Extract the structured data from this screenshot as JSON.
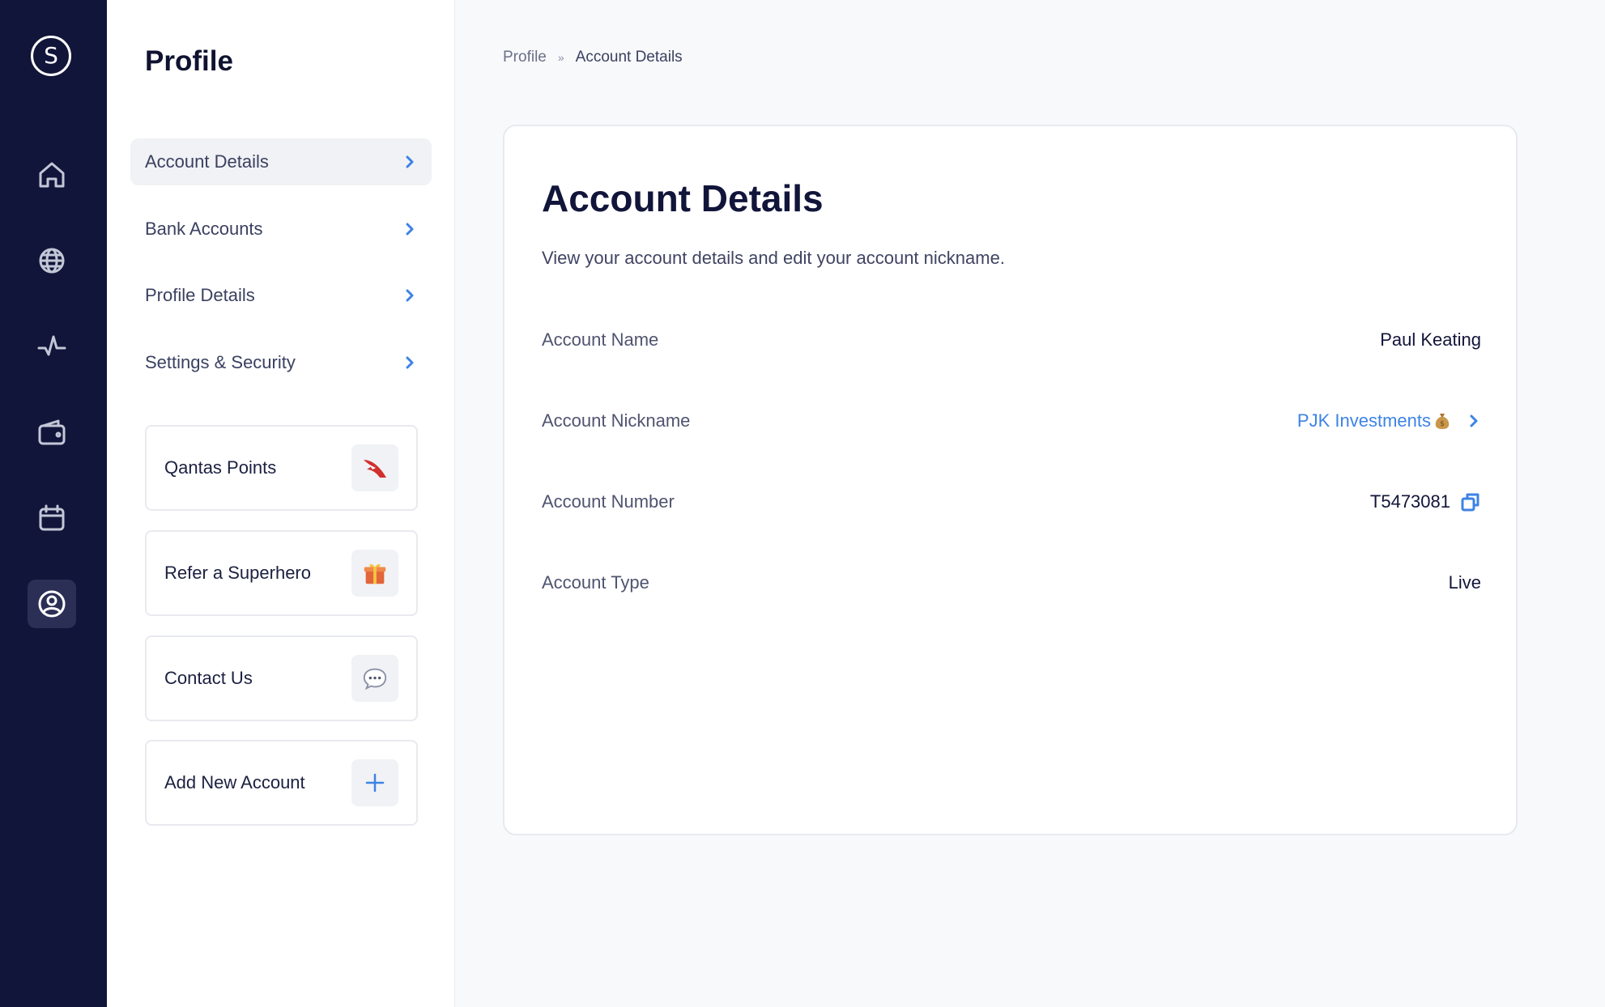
{
  "rail": {
    "logo_letter": "S",
    "items": [
      {
        "icon": "home-icon"
      },
      {
        "icon": "globe-icon"
      },
      {
        "icon": "activity-icon"
      },
      {
        "icon": "wallet-icon"
      },
      {
        "icon": "calendar-icon"
      },
      {
        "icon": "profile-icon",
        "active": true
      }
    ]
  },
  "panel": {
    "title": "Profile",
    "menu": [
      {
        "label": "Account Details",
        "active": true
      },
      {
        "label": "Bank Accounts"
      },
      {
        "label": "Profile Details"
      },
      {
        "label": "Settings & Security"
      }
    ],
    "cards": [
      {
        "label": "Qantas Points",
        "icon": "qantas-logo-icon"
      },
      {
        "label": "Refer a Superhero",
        "icon": "gift-icon"
      },
      {
        "label": "Contact Us",
        "icon": "chat-bubble-icon"
      },
      {
        "label": "Add New Account",
        "icon": "plus-icon"
      }
    ]
  },
  "breadcrumb": {
    "parent": "Profile",
    "separator": "»",
    "current": "Account Details"
  },
  "main": {
    "title": "Account Details",
    "description": "View your account details and edit your account nickname.",
    "rows": [
      {
        "label": "Account Name",
        "value": "Paul Keating"
      },
      {
        "label": "Account Nickname",
        "value": "PJK Investments"
      },
      {
        "label": "Account Number",
        "value": "T5473081"
      },
      {
        "label": "Account Type",
        "value": "Live"
      }
    ]
  },
  "colors": {
    "rail_bg": "#12153a",
    "accent": "#3d83e6",
    "qantas_red": "#d0312d"
  }
}
